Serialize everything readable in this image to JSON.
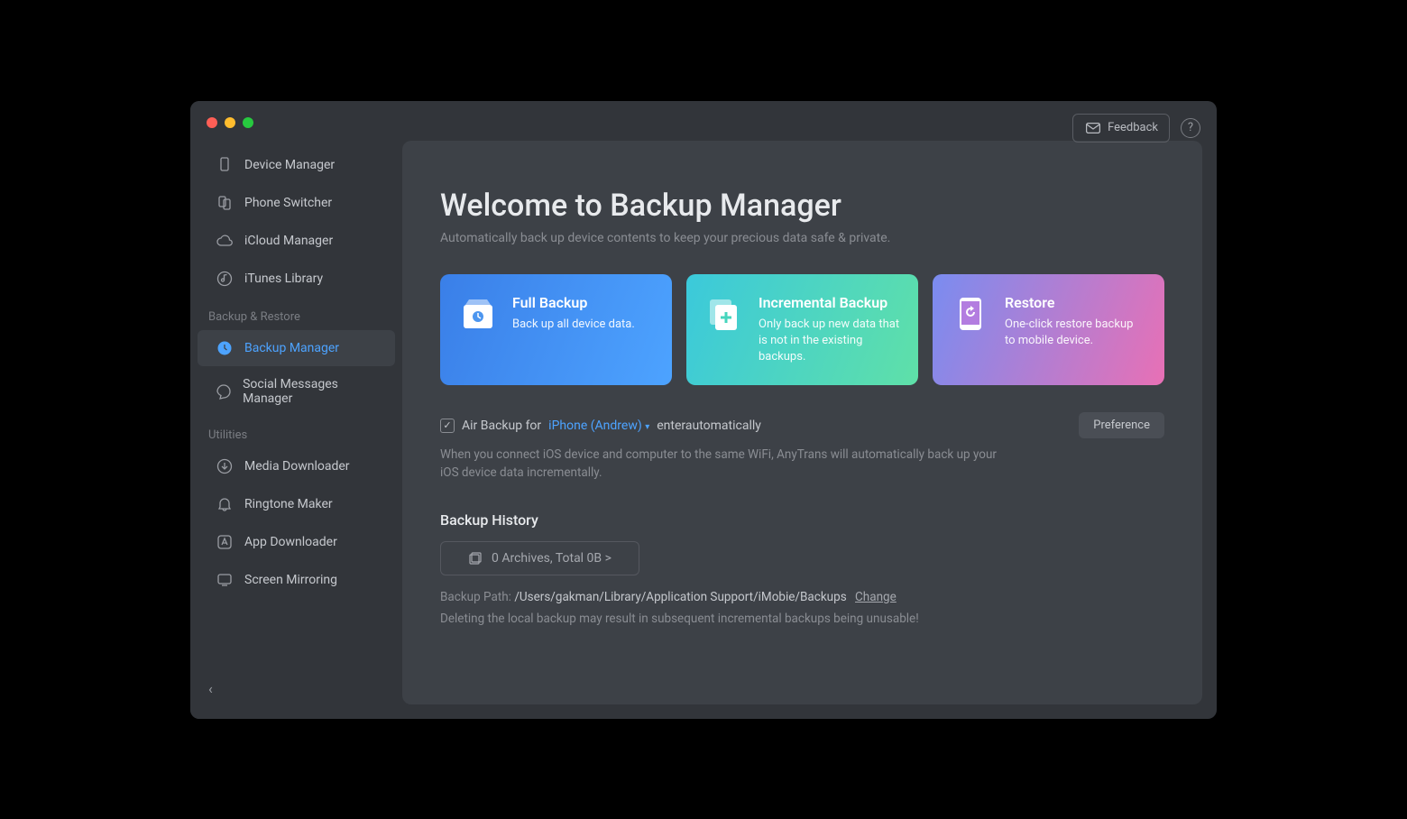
{
  "header": {
    "feedback_label": "Feedback"
  },
  "sidebar": {
    "items_top": [
      {
        "label": "Device Manager"
      },
      {
        "label": "Phone Switcher"
      },
      {
        "label": "iCloud Manager"
      },
      {
        "label": "iTunes Library"
      }
    ],
    "section_backup": "Backup & Restore",
    "items_backup": [
      {
        "label": "Backup Manager"
      },
      {
        "label": "Social Messages Manager"
      }
    ],
    "section_utilities": "Utilities",
    "items_utilities": [
      {
        "label": "Media Downloader"
      },
      {
        "label": "Ringtone Maker"
      },
      {
        "label": "App Downloader"
      },
      {
        "label": "Screen Mirroring"
      }
    ]
  },
  "main": {
    "title": "Welcome to Backup Manager",
    "subtitle": "Automatically back up device contents to keep your precious data safe & private.",
    "cards": {
      "full": {
        "title": "Full Backup",
        "desc": "Back up all device data."
      },
      "incremental": {
        "title": "Incremental Backup",
        "desc": "Only back up new data that is not in the existing backups."
      },
      "restore": {
        "title": "Restore",
        "desc": "One-click restore backup to mobile device."
      }
    },
    "air": {
      "prefix": "Air Backup for",
      "device": "iPhone (Andrew)",
      "suffix": "enterautomatically",
      "preference_label": "Preference",
      "desc": "When you connect iOS device and computer to the same WiFi, AnyTrans will automatically back up your iOS device data incrementally."
    },
    "history": {
      "title": "Backup History",
      "archives": "0 Archives, Total  0B >",
      "path_label": "Backup Path:",
      "path_value": "/Users/gakman/Library/Application Support/iMobie/Backups",
      "change_label": "Change",
      "warning": "Deleting the local backup may result in subsequent incremental backups being unusable!"
    }
  }
}
